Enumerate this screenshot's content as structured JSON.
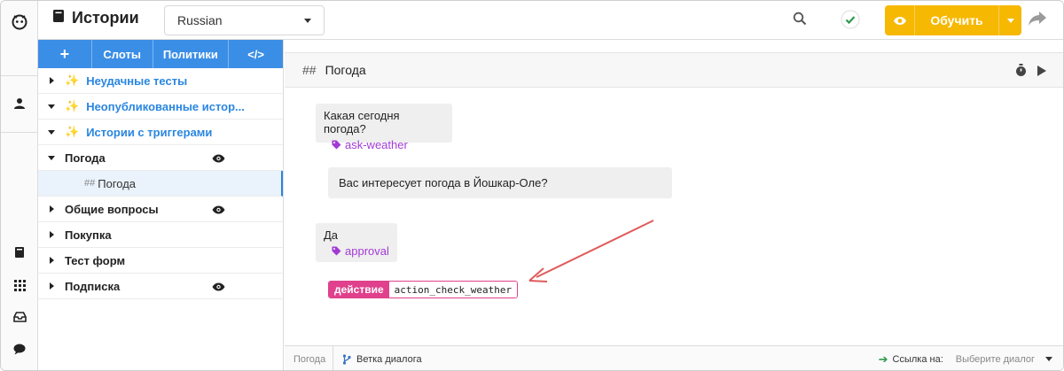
{
  "header": {
    "title": "Истории",
    "language": "Russian",
    "train_label": "Обучить",
    "icons": [
      "book-icon",
      "search-icon",
      "check-circle-icon",
      "eye-icon",
      "chevron-down-icon",
      "share-icon"
    ],
    "accent_color": "#f6b800"
  },
  "rail": {
    "icons": [
      "bot-logo-icon",
      "user-icon",
      "book-icon",
      "grid-icon",
      "inbox-icon",
      "chat-icon"
    ]
  },
  "sidebar": {
    "tabs": [
      {
        "label": "+"
      },
      {
        "label": "Слоты"
      },
      {
        "label": "Политики"
      },
      {
        "label": "</>"
      }
    ],
    "tab_color": "#3b8ee6",
    "items": [
      {
        "label": "Неудачные тесты",
        "expanded": false,
        "smart": true
      },
      {
        "label": "Неопубликованные истор...",
        "expanded": true,
        "smart": true
      },
      {
        "label": "Истории с триггерами",
        "expanded": true,
        "smart": true
      },
      {
        "label": "Погода",
        "expanded": true,
        "smart": false,
        "eye": true
      },
      {
        "label": "Погода",
        "child": true,
        "selected": true
      },
      {
        "label": "Общие вопросы",
        "expanded": false,
        "smart": false,
        "eye": true
      },
      {
        "label": "Покупка",
        "expanded": false,
        "smart": false
      },
      {
        "label": "Тест форм",
        "expanded": false,
        "smart": false
      },
      {
        "label": "Подписка",
        "expanded": false,
        "smart": false,
        "eye": true
      }
    ]
  },
  "story": {
    "title": "Погода",
    "hash": "##",
    "messages": [
      {
        "text": "Какая сегодня погода?",
        "intent": "ask-weather"
      },
      {
        "text": "Вас интересует погода в Йошкар-Оле?"
      },
      {
        "text": "Да",
        "intent": "approval"
      }
    ],
    "action": {
      "key": "действие",
      "value": "action_check_weather"
    },
    "intent_color": "#a23bd6",
    "action_color": "#e0408c",
    "annotation_arrow_color": "#e05a5a"
  },
  "footer": {
    "breadcrumb": "Погода",
    "branch_label": "Ветка диалога",
    "link_label": "Ссылка на:",
    "link_placeholder": "Выберите диалог"
  }
}
